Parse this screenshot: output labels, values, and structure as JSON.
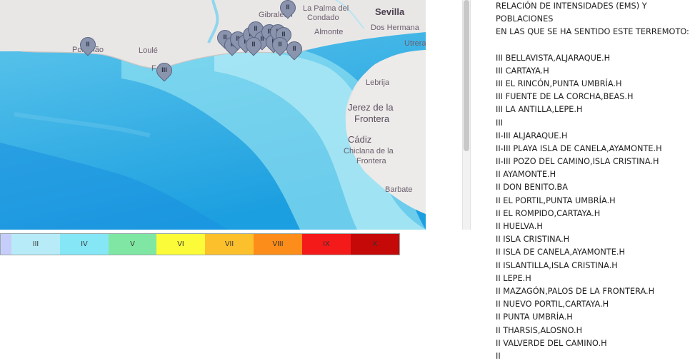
{
  "map": {
    "places": [
      {
        "id": "gibraleon",
        "text": "Gibraleón",
        "style": "place"
      },
      {
        "id": "la-palma",
        "text": "La Palma del",
        "style": "place"
      },
      {
        "id": "condado",
        "text": "Condado",
        "style": "place"
      },
      {
        "id": "sevilla",
        "text": "Sevilla",
        "style": "big"
      },
      {
        "id": "almonte",
        "text": "Almonte",
        "style": "place"
      },
      {
        "id": "dos-hermanas",
        "text": "Dos Hermana",
        "style": "place"
      },
      {
        "id": "utrera",
        "text": "Utrera",
        "style": "place"
      },
      {
        "id": "portimao",
        "text": "Portimão",
        "style": "place"
      },
      {
        "id": "loule",
        "text": "Loulé",
        "style": "place"
      },
      {
        "id": "faro",
        "text": "F",
        "style": "place"
      },
      {
        "id": "huelva",
        "text": "va",
        "style": "place"
      },
      {
        "id": "lebrija",
        "text": "Lebrija",
        "style": "place"
      },
      {
        "id": "jerez1",
        "text": "Jerez de la",
        "style": "city"
      },
      {
        "id": "jerez2",
        "text": "Frontera",
        "style": "city"
      },
      {
        "id": "cadiz",
        "text": "Cádiz",
        "style": "city"
      },
      {
        "id": "chiclana1",
        "text": "Chiclana de la",
        "style": "place"
      },
      {
        "id": "chiclana2",
        "text": "Frontera",
        "style": "place"
      },
      {
        "id": "barbate",
        "text": "Barbate",
        "style": "place"
      }
    ],
    "markers": [
      {
        "label": "II"
      },
      {
        "label": "III"
      },
      {
        "label": "II"
      },
      {
        "label": "II"
      },
      {
        "label": "II"
      },
      {
        "label": "II"
      },
      {
        "label": "II"
      },
      {
        "label": "II"
      },
      {
        "label": "II"
      },
      {
        "label": "II"
      },
      {
        "label": "II"
      },
      {
        "label": "II"
      },
      {
        "label": "II"
      },
      {
        "label": "II"
      },
      {
        "label": "II"
      },
      {
        "label": "II"
      },
      {
        "label": "II"
      }
    ]
  },
  "legend": [
    {
      "label": "",
      "color": "#c7cdfa"
    },
    {
      "label": "III",
      "color": "#b7ebf7"
    },
    {
      "label": "IV",
      "color": "#85e6f5"
    },
    {
      "label": "V",
      "color": "#7fe7a3"
    },
    {
      "label": "VI",
      "color": "#fbfb3a"
    },
    {
      "label": "VII",
      "color": "#fcc02c"
    },
    {
      "label": "VIII",
      "color": "#fd8d1a"
    },
    {
      "label": "IX",
      "color": "#f51a1a"
    },
    {
      "label": "X",
      "color": "#c50808"
    }
  ],
  "report": {
    "header": [
      "RELACIÓN DE INTENSIDADES (EMS) Y",
      "POBLACIONES",
      "EN LAS QUE SE HA SENTIDO ESTE TERREMOTO:"
    ],
    "items": [
      "III BELLAVISTA,ALJARAQUE.H",
      "III CARTAYA.H",
      "III EL RINCÓN,PUNTA UMBRÍA.H",
      "III FUENTE DE LA CORCHA,BEAS.H",
      "III LA ANTILLA,LEPE.H",
      "III",
      "II-III ALJARAQUE.H",
      "II-III PLAYA ISLA DE CANELA,AYAMONTE.H",
      "II-III POZO DEL CAMINO,ISLA CRISTINA.H",
      "II AYAMONTE.H",
      "II DON BENITO.BA",
      "II EL PORTIL,PUNTA UMBRÍA.H",
      "II EL ROMPIDO,CARTAYA.H",
      "II HUELVA.H",
      "II ISLA CRISTINA.H",
      "II ISLA DE CANELA,AYAMONTE.H",
      "II ISLANTILLA,ISLA CRISTINA.H",
      "II LEPE.H",
      "II MAZAGÓN,PALOS DE LA FRONTERA.H",
      "II NUEVO PORTIL,CARTAYA.H",
      "II PUNTA UMBRÍA.H",
      "II THARSIS,ALOSNO.H",
      "II VALVERDE DEL CAMINO.H",
      "II"
    ]
  }
}
